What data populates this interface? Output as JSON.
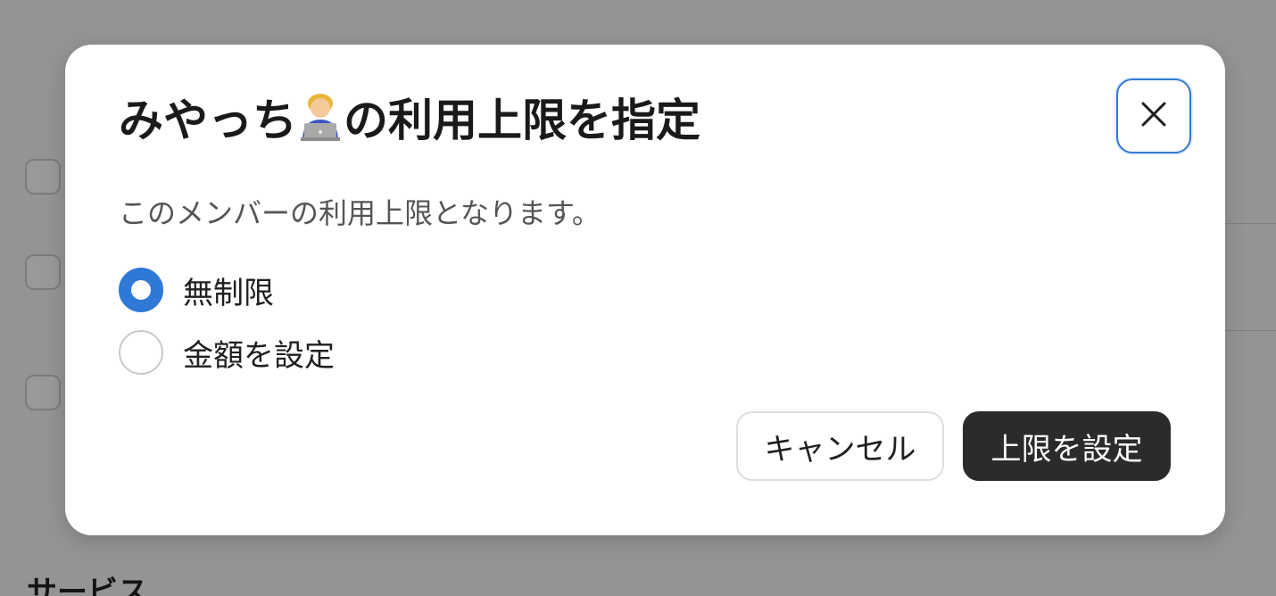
{
  "background": {
    "section_heading": "サービス"
  },
  "modal": {
    "title_prefix": "みやっち",
    "title_emoji": "technologist-icon",
    "title_suffix": "の利用上限を指定",
    "description": "このメンバーの利用上限となります。",
    "close_icon": "close-icon",
    "options": [
      {
        "label": "無制限",
        "selected": true
      },
      {
        "label": "金額を設定",
        "selected": false
      }
    ],
    "cancel_label": "キャンセル",
    "submit_label": "上限を設定"
  },
  "colors": {
    "accent": "#2f78d6",
    "primary_button": "#2b2b29",
    "overlay": "#9a9a9a"
  }
}
